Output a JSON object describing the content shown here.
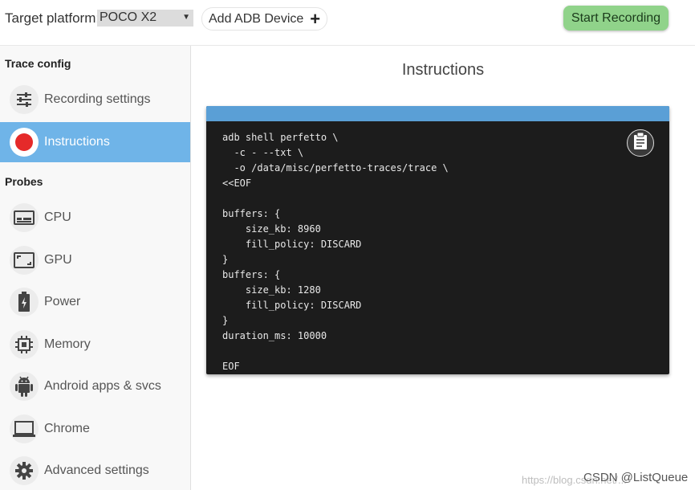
{
  "topbar": {
    "target_label": "Target platform:",
    "platform_value": "POCO X2",
    "add_adb_label": "Add ADB Device",
    "start_recording_label": "Start Recording"
  },
  "sidebar": {
    "trace_config_title": "Trace config",
    "trace_items": [
      {
        "label": "Recording settings",
        "icon": "tune-icon",
        "active": false
      },
      {
        "label": "Instructions",
        "icon": "record-dot-icon",
        "active": true
      }
    ],
    "probes_title": "Probes",
    "probe_items": [
      {
        "label": "CPU",
        "icon": "cpu-icon"
      },
      {
        "label": "GPU",
        "icon": "gpu-icon"
      },
      {
        "label": "Power",
        "icon": "battery-icon"
      },
      {
        "label": "Memory",
        "icon": "memory-chip-icon"
      },
      {
        "label": "Android apps & svcs",
        "icon": "android-icon"
      },
      {
        "label": "Chrome",
        "icon": "laptop-icon"
      },
      {
        "label": "Advanced settings",
        "icon": "gear-icon"
      }
    ]
  },
  "main": {
    "title": "Instructions",
    "code": "adb shell perfetto \\\n  -c - --txt \\\n  -o /data/misc/perfetto-traces/trace \\\n<<EOF\n\nbuffers: {\n    size_kb: 8960\n    fill_policy: DISCARD\n}\nbuffers: {\n    size_kb: 1280\n    fill_policy: DISCARD\n}\nduration_ms: 10000\n\nEOF",
    "copy_icon": "clipboard-icon"
  },
  "watermark": {
    "faded_url": "https://blog.csdn.net/...",
    "csdn": "CSDN @ListQueue"
  },
  "colors": {
    "accent_blue": "#6fb4e8",
    "start_green": "#90d38a",
    "record_red": "#e52a2a",
    "code_bg": "#1c1c1c"
  }
}
